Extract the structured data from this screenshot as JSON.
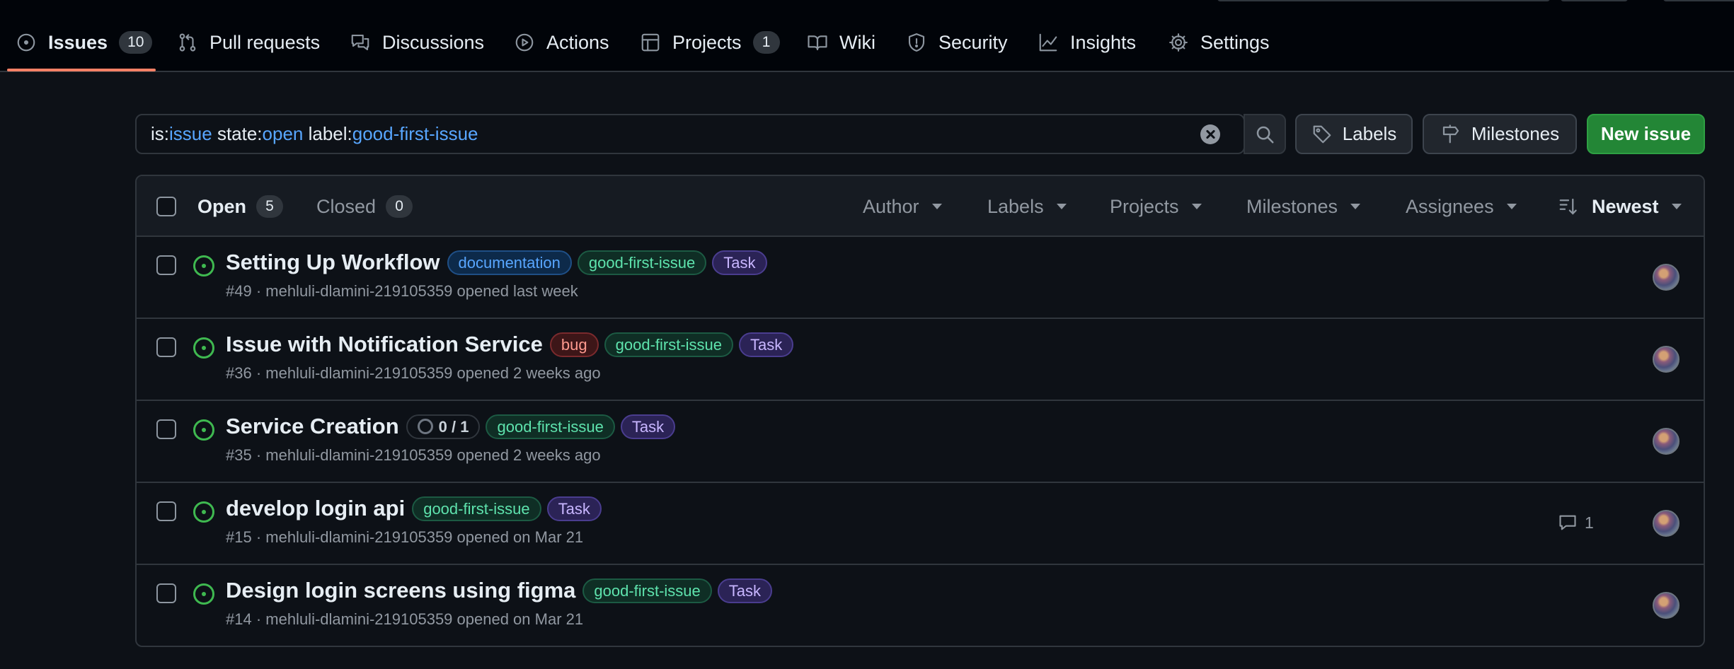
{
  "nav": {
    "tabs": [
      {
        "label": "Issues",
        "count": "10",
        "icon": "issue-opened-icon"
      },
      {
        "label": "Pull requests",
        "icon": "git-pull-request-icon"
      },
      {
        "label": "Discussions",
        "icon": "comment-discussion-icon"
      },
      {
        "label": "Actions",
        "icon": "play-icon"
      },
      {
        "label": "Projects",
        "count": "1",
        "icon": "table-icon"
      },
      {
        "label": "Wiki",
        "icon": "book-icon"
      },
      {
        "label": "Security",
        "icon": "shield-icon"
      },
      {
        "label": "Insights",
        "icon": "graph-icon"
      },
      {
        "label": "Settings",
        "icon": "gear-icon"
      }
    ]
  },
  "search": {
    "tokens": [
      {
        "key": "is:",
        "value": "issue"
      },
      {
        "key": "state:",
        "value": "open"
      },
      {
        "key": "label:",
        "value": "good-first-issue"
      }
    ]
  },
  "toolbar": {
    "labels_button": "Labels",
    "milestones_button": "Milestones",
    "new_issue_button": "New issue"
  },
  "list": {
    "open_label": "Open",
    "open_count": "5",
    "closed_label": "Closed",
    "closed_count": "0",
    "filters": [
      "Author",
      "Labels",
      "Projects",
      "Milestones",
      "Assignees"
    ],
    "sort_label": "Newest"
  },
  "issues": [
    {
      "title": "Setting Up Workflow",
      "labels": [
        {
          "text": "documentation",
          "kind": "doc"
        },
        {
          "text": "good-first-issue",
          "kind": "gfi"
        },
        {
          "text": "Task",
          "kind": "task"
        }
      ],
      "meta": "#49 · mehluli-dlamini-219105359 opened last week",
      "comments": ""
    },
    {
      "title": "Issue with Notification Service",
      "labels": [
        {
          "text": "bug",
          "kind": "bug"
        },
        {
          "text": "good-first-issue",
          "kind": "gfi"
        },
        {
          "text": "Task",
          "kind": "task"
        }
      ],
      "meta": "#36 · mehluli-dlamini-219105359 opened 2 weeks ago",
      "comments": ""
    },
    {
      "title": "Service Creation",
      "progress": "0 / 1",
      "labels": [
        {
          "text": "good-first-issue",
          "kind": "gfi"
        },
        {
          "text": "Task",
          "kind": "task"
        }
      ],
      "meta": "#35 · mehluli-dlamini-219105359 opened 2 weeks ago",
      "comments": ""
    },
    {
      "title": "develop login api",
      "labels": [
        {
          "text": "good-first-issue",
          "kind": "gfi"
        },
        {
          "text": "Task",
          "kind": "task"
        }
      ],
      "meta": "#15 · mehluli-dlamini-219105359 opened on Mar 21",
      "comments": "1"
    },
    {
      "title": "Design login screens using figma",
      "labels": [
        {
          "text": "good-first-issue",
          "kind": "gfi"
        },
        {
          "text": "Task",
          "kind": "task"
        }
      ],
      "meta": "#14 · mehluli-dlamini-219105359 opened on Mar 21",
      "comments": ""
    }
  ],
  "colors": {
    "background": "#0d1117",
    "accent_underline": "#f78166",
    "open_state": "#3fb950",
    "primary_button": "#238636",
    "query_value": "#58a6ff"
  }
}
